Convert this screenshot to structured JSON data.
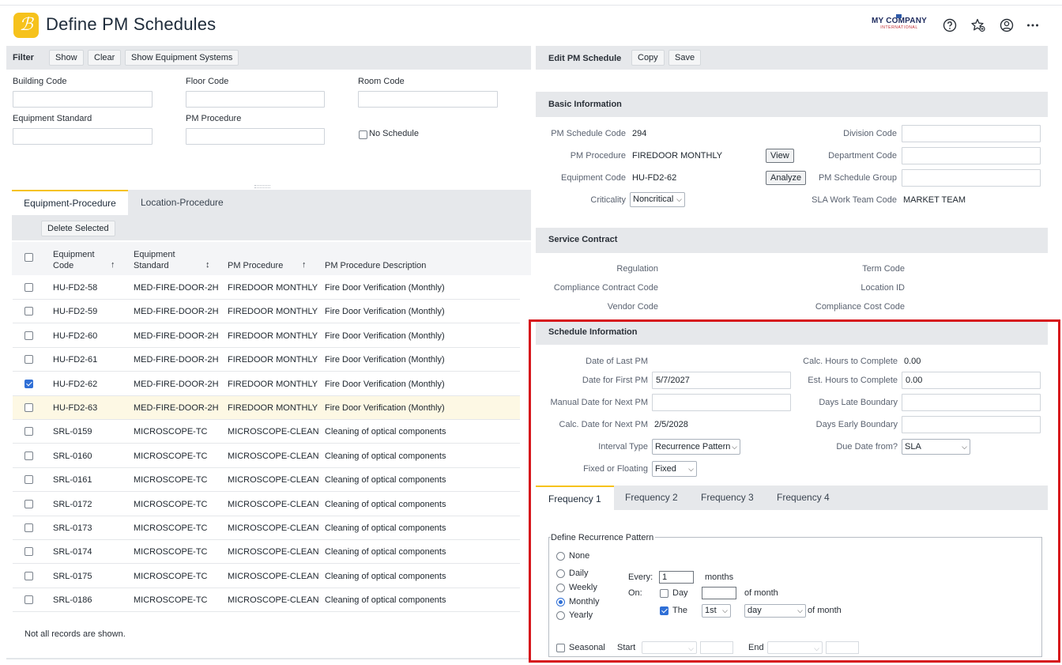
{
  "app": {
    "title": "Define PM Schedules",
    "brand_name": "MY COMPANY",
    "brand_sub": "INTERNATIONAL"
  },
  "header_icons": [
    "help-icon",
    "favorites-star-icon",
    "user-profile-icon",
    "more-options-icon"
  ],
  "filter": {
    "title": "Filter",
    "show_label": "Show",
    "clear_label": "Clear",
    "show_systems_label": "Show Equipment Systems",
    "building_code_label": "Building Code",
    "floor_code_label": "Floor Code",
    "room_code_label": "Room Code",
    "equipment_standard_label": "Equipment Standard",
    "pm_procedure_label": "PM Procedure",
    "no_schedule_label": "No Schedule"
  },
  "left_tabs": {
    "equipment_procedure": "Equipment-Procedure",
    "location_procedure": "Location-Procedure"
  },
  "delete_selected_label": "Delete Selected",
  "table": {
    "headers": {
      "equipment_code": "Equipment Code",
      "equipment_standard": "Equipment Standard",
      "pm_procedure": "PM Procedure",
      "pm_procedure_description": "PM Procedure Description"
    },
    "rows": [
      {
        "code": "HU-FD2-58",
        "standard": "MED-FIRE-DOOR-2H",
        "procedure": "FIREDOOR MONTHLY",
        "description": "Fire Door Verification (Monthly)",
        "checked": false
      },
      {
        "code": "HU-FD2-59",
        "standard": "MED-FIRE-DOOR-2H",
        "procedure": "FIREDOOR MONTHLY",
        "description": "Fire Door Verification (Monthly)",
        "checked": false
      },
      {
        "code": "HU-FD2-60",
        "standard": "MED-FIRE-DOOR-2H",
        "procedure": "FIREDOOR MONTHLY",
        "description": "Fire Door Verification (Monthly)",
        "checked": false
      },
      {
        "code": "HU-FD2-61",
        "standard": "MED-FIRE-DOOR-2H",
        "procedure": "FIREDOOR MONTHLY",
        "description": "Fire Door Verification (Monthly)",
        "checked": false
      },
      {
        "code": "HU-FD2-62",
        "standard": "MED-FIRE-DOOR-2H",
        "procedure": "FIREDOOR MONTHLY",
        "description": "Fire Door Verification (Monthly)",
        "checked": true
      },
      {
        "code": "HU-FD2-63",
        "standard": "MED-FIRE-DOOR-2H",
        "procedure": "FIREDOOR MONTHLY",
        "description": "Fire Door Verification (Monthly)",
        "checked": false
      },
      {
        "code": "SRL-0159",
        "standard": "MICROSCOPE-TC",
        "procedure": "MICROSCOPE-CLEAN",
        "description": "Cleaning of optical components",
        "checked": false
      },
      {
        "code": "SRL-0160",
        "standard": "MICROSCOPE-TC",
        "procedure": "MICROSCOPE-CLEAN",
        "description": "Cleaning of optical components",
        "checked": false
      },
      {
        "code": "SRL-0161",
        "standard": "MICROSCOPE-TC",
        "procedure": "MICROSCOPE-CLEAN",
        "description": "Cleaning of optical components",
        "checked": false
      },
      {
        "code": "SRL-0172",
        "standard": "MICROSCOPE-TC",
        "procedure": "MICROSCOPE-CLEAN",
        "description": "Cleaning of optical components",
        "checked": false
      },
      {
        "code": "SRL-0173",
        "standard": "MICROSCOPE-TC",
        "procedure": "MICROSCOPE-CLEAN",
        "description": "Cleaning of optical components",
        "checked": false
      },
      {
        "code": "SRL-0174",
        "standard": "MICROSCOPE-TC",
        "procedure": "MICROSCOPE-CLEAN",
        "description": "Cleaning of optical components",
        "checked": false
      },
      {
        "code": "SRL-0175",
        "standard": "MICROSCOPE-TC",
        "procedure": "MICROSCOPE-CLEAN",
        "description": "Cleaning of optical components",
        "checked": false
      },
      {
        "code": "SRL-0186",
        "standard": "MICROSCOPE-TC",
        "procedure": "MICROSCOPE-CLEAN",
        "description": "Cleaning of optical components",
        "checked": false
      }
    ],
    "footer_note": "Not all records are shown."
  },
  "edit": {
    "title": "Edit PM Schedule",
    "copy_label": "Copy",
    "save_label": "Save"
  },
  "basic": {
    "title": "Basic Information",
    "schedule_code_label": "PM Schedule Code",
    "schedule_code": "294",
    "procedure_label": "PM Procedure",
    "procedure": "FIREDOOR MONTHLY",
    "view_label": "View",
    "equipment_code_label": "Equipment Code",
    "equipment_code": "HU-FD2-62",
    "analyze_label": "Analyze",
    "criticality_label": "Criticality",
    "criticality": "Noncritical",
    "division_code_label": "Division Code",
    "department_code_label": "Department Code",
    "schedule_group_label": "PM Schedule Group",
    "sla_team_label": "SLA Work Team Code",
    "sla_team": "MARKET TEAM"
  },
  "contract": {
    "title": "Service Contract",
    "regulation_label": "Regulation",
    "compliance_code_label": "Compliance Contract Code",
    "vendor_code_label": "Vendor Code",
    "term_code_label": "Term Code",
    "location_id_label": "Location ID",
    "compliance_cost_label": "Compliance Cost Code"
  },
  "schedule": {
    "title": "Schedule Information",
    "last_pm_label": "Date of Last PM",
    "first_pm_label": "Date for First PM",
    "first_pm": "5/7/2027",
    "manual_next_label": "Manual Date for Next PM",
    "calc_next_label": "Calc. Date for Next PM",
    "calc_next": "2/5/2028",
    "interval_type_label": "Interval Type",
    "interval_type": "Recurrence Pattern",
    "fixed_floating_label": "Fixed or Floating",
    "fixed_floating": "Fixed",
    "calc_hours_label": "Calc. Hours to Complete",
    "calc_hours": "0.00",
    "est_hours_label": "Est. Hours to Complete",
    "est_hours": "0.00",
    "days_late_label": "Days Late Boundary",
    "days_early_label": "Days Early Boundary",
    "due_date_from_label": "Due Date from?",
    "due_date_from": "SLA"
  },
  "freq_tabs": [
    "Frequency 1",
    "Frequency 2",
    "Frequency 3",
    "Frequency 4"
  ],
  "recurrence": {
    "legend": "Define Recurrence Pattern",
    "options": [
      "None",
      "Daily",
      "Weekly",
      "Monthly",
      "Yearly"
    ],
    "selected": "Monthly",
    "every_label": "Every:",
    "every_value": "1",
    "months_label": "months",
    "on_label": "On:",
    "day_label": "Day",
    "of_month_label": "of month",
    "the_label": "The",
    "ordinal": "1st",
    "day_select": "day",
    "of_month_label_2": "of month",
    "seasonal_label": "Seasonal",
    "start_label": "Start",
    "end_label": "End"
  }
}
